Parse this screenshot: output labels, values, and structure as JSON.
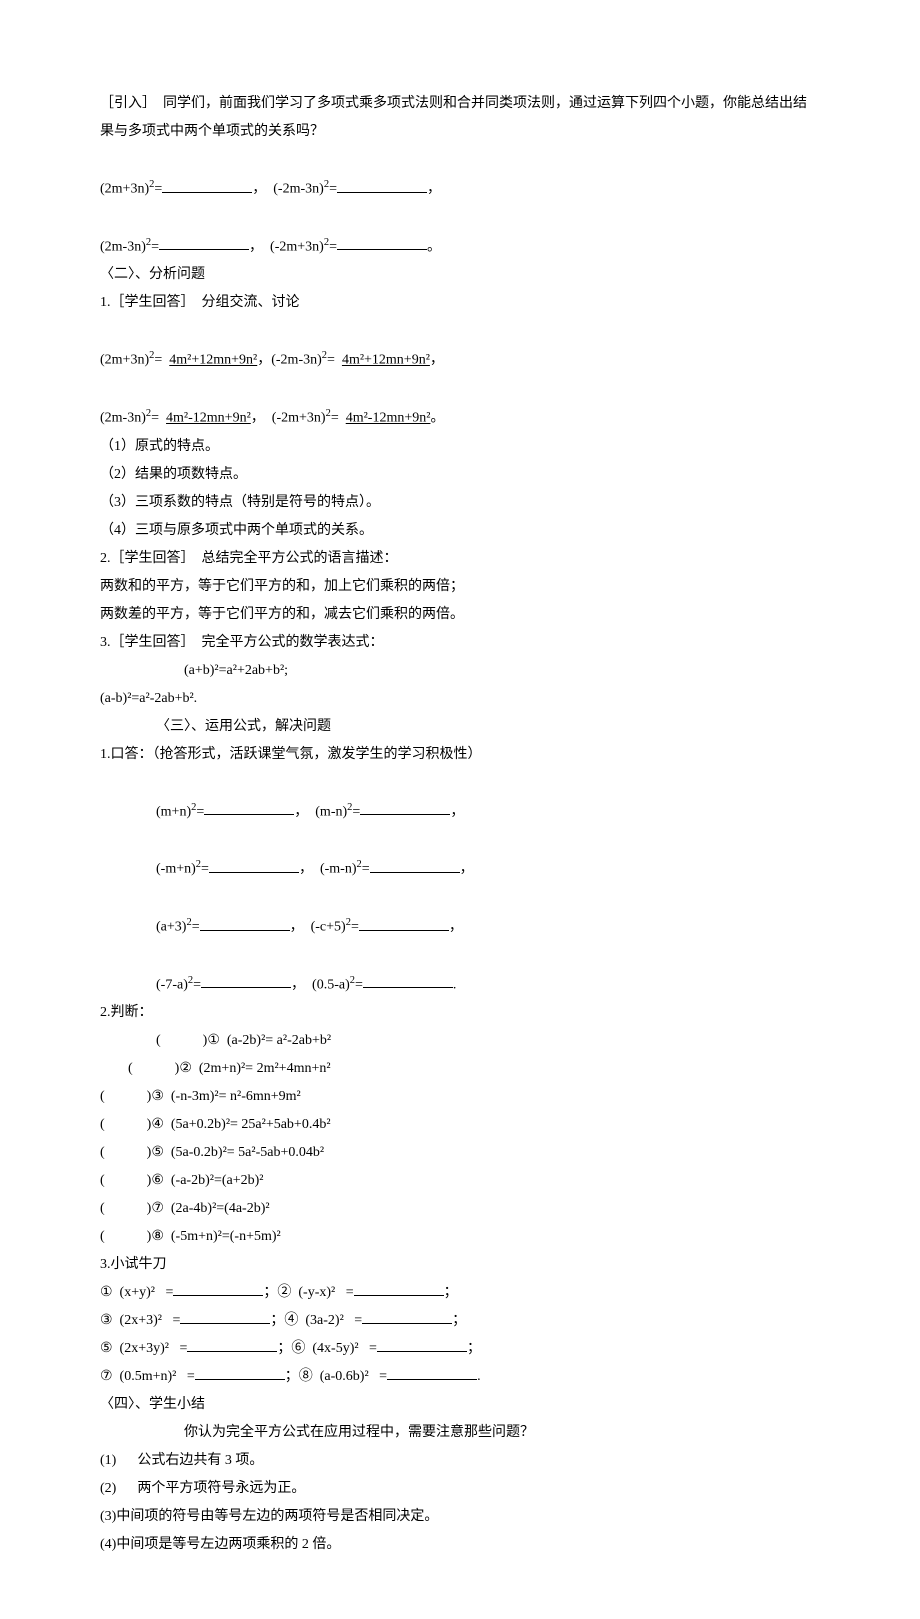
{
  "intro_label": "［引入］",
  "intro_text": "  同学们，前面我们学习了多项式乘多项式法则和合并同类项法则，通过运算下列四个小题，你能总结出结果与多项式中两个单项式的关系吗？",
  "blank_row1_a_expr": "(2m+3n)",
  "blank_row1_b_expr": "(-2m-3n)",
  "blank_row2_a_expr": "(2m-3n)",
  "blank_row2_b_expr": "(-2m+3n)",
  "sq_eq": "=",
  "comma": "，",
  "period": "。",
  "sec2": "〈二〉、分析问题",
  "s2_q1": "1.［学生回答］  分组交流、讨论",
  "ans1_a_expr": "(2m+3n)",
  "ans1_a_rhs": "4m²+12mn+9n²",
  "ans1_b_expr": "(-2m-3n)",
  "ans1_b_rhs": "4m²+12mn+9n²",
  "ans2_a_expr": "(2m-3n)",
  "ans2_a_rhs": "4m²-12mn+9n²",
  "ans2_b_expr": "(-2m+3n)",
  "ans2_b_rhs": "4m²-12mn+9n²",
  "bullets": [
    "（1）原式的特点。",
    "（2）结果的项数特点。",
    "（3）三项系数的特点（特别是符号的特点）。",
    "（4）三项与原多项式中两个单项式的关系。"
  ],
  "s2_q2": "2.［学生回答］  总结完全平方公式的语言描述：",
  "s2_q2_l1": "两数和的平方，等于它们平方的和，加上它们乘积的两倍；",
  "s2_q2_l2": "两数差的平方，等于它们平方的和，减去它们乘积的两倍。",
  "s2_q3": "3.［学生回答］  完全平方公式的数学表达式：",
  "formula1": "(a+b)²=a²+2ab+b²;",
  "formula2": "(a-b)²=a²-2ab+b².",
  "sec3": "〈三〉、运用公式，解决问题",
  "s3_q1": "1.口答：（抢答形式，活跃课堂气氛，激发学生的学习积极性）",
  "oral": [
    [
      "(m+n)",
      "(m-n)"
    ],
    [
      "(-m+n)",
      "(-m-n)"
    ],
    [
      "(a+3)",
      "(-c+5)"
    ],
    [
      "(-7-a)",
      "(0.5-a)"
    ]
  ],
  "s3_q2": "2.判断：",
  "judge": [
    "①  (a-2b)²= a²-2ab+b²",
    "②  (2m+n)²= 2m²+4mn+n²",
    "③  (-n-3m)²= n²-6mn+9m²",
    "④  (5a+0.2b)²= 25a²+5ab+0.4b²",
    "⑤  (5a-0.2b)²= 5a²-5ab+0.04b²",
    "⑥  (-a-2b)²=(a+2b)²",
    "⑦  (2a-4b)²=(4a-2b)²",
    "⑧  (-5m+n)²=(-n+5m)²"
  ],
  "s3_q3": "3.小试牛刀",
  "try": [
    [
      "①  (x+y)²   =",
      "；②  (-y-x)²   =",
      "；"
    ],
    [
      "③  (2x+3)²   =",
      "；④  (3a-2)²   =",
      "；"
    ],
    [
      "⑤  (2x+3y)²   =",
      "；⑥  (4x-5y)²   =",
      "；"
    ],
    [
      "⑦  (0.5m+n)²   =",
      "；⑧  (a-0.6b)²   =",
      "."
    ]
  ],
  "sec4": "〈四〉、学生小结",
  "sec4_q": "你认为完全平方公式在应用过程中，需要注意那些问题？",
  "sec4_items": [
    "(1)　  公式右边共有 3 项。",
    "(2)　  两个平方项符号永远为正。",
    "(3)中间项的符号由等号左边的两项符号是否相同决定。",
    "(4)中间项是等号左边两项乘积的 2 倍。"
  ]
}
